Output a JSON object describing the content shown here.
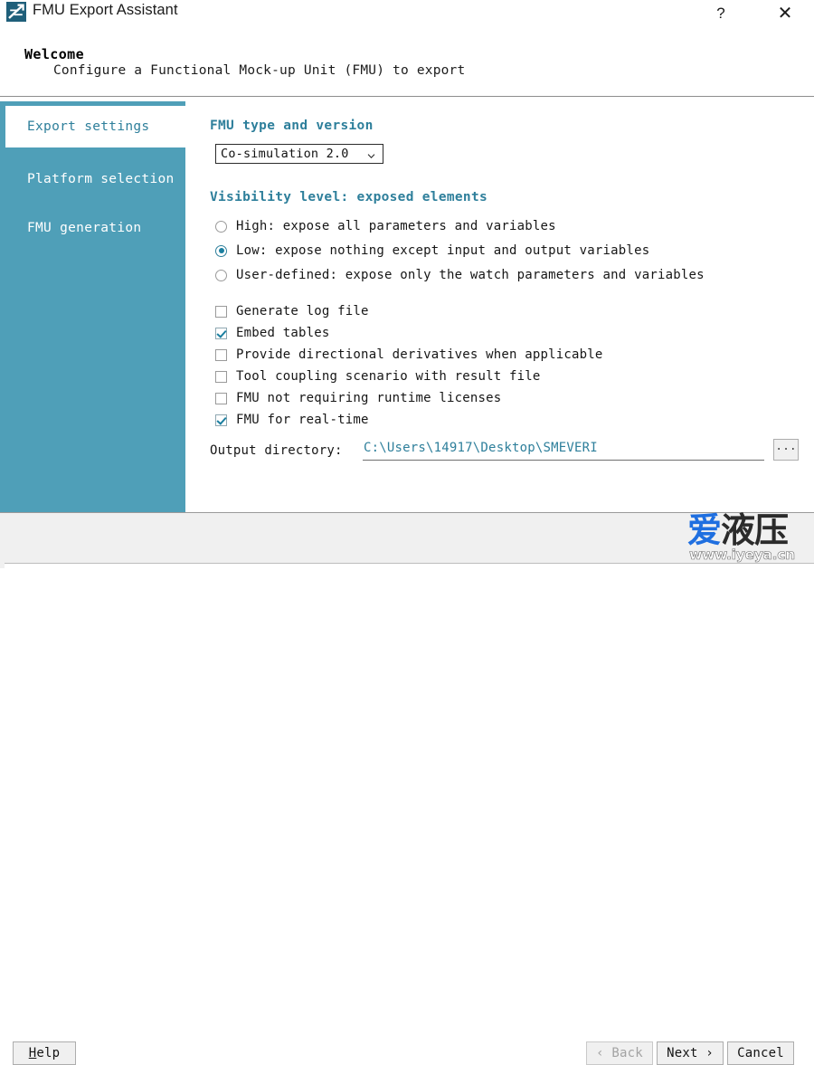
{
  "window": {
    "title": "FMU Export Assistant",
    "icon": "fmu-app-icon",
    "help_icon": "?",
    "close_icon": "✕"
  },
  "header": {
    "title": "Welcome",
    "subtitle": "Configure a Functional Mock-up Unit (FMU) to export"
  },
  "sidebar": {
    "accent_color": "#4f9fb8",
    "active_text_color": "#2e7f9b",
    "items": [
      {
        "label": "Export settings",
        "active": true
      },
      {
        "label": "Platform selection",
        "active": false
      },
      {
        "label": "FMU generation",
        "active": false
      }
    ]
  },
  "main": {
    "fmu_type": {
      "heading": "FMU type and version",
      "selected": "Co-simulation 2.0",
      "chevron": "⌄",
      "options": [
        "Co-simulation 2.0"
      ]
    },
    "visibility": {
      "heading": "Visibility level: exposed elements",
      "options": [
        {
          "label": "High: expose all parameters and variables",
          "selected": false
        },
        {
          "label": "Low: expose nothing except input and output variables",
          "selected": true
        },
        {
          "label": "User-defined: expose only the watch parameters and variables",
          "selected": false
        }
      ]
    },
    "checkboxes": [
      {
        "label": "Generate log file",
        "checked": false
      },
      {
        "label": "Embed tables",
        "checked": true
      },
      {
        "label": "Provide directional derivatives when applicable",
        "checked": false
      },
      {
        "label": "Tool coupling scenario with result file",
        "checked": false
      },
      {
        "label": "FMU not requiring runtime licenses",
        "checked": false
      },
      {
        "label": "FMU for real-time",
        "checked": true
      }
    ],
    "output_directory": {
      "label": "Output directory:",
      "value": "C:\\Users\\14917\\Desktop\\SMEVERI",
      "browse_label": "..."
    }
  },
  "footer": {
    "help": "Help",
    "back": "‹ Back",
    "next": "Next ›",
    "cancel": "Cancel"
  },
  "watermark": {
    "cn_blue": "爱",
    "cn_dark": "液压",
    "url": "www.iyeya.cn"
  }
}
